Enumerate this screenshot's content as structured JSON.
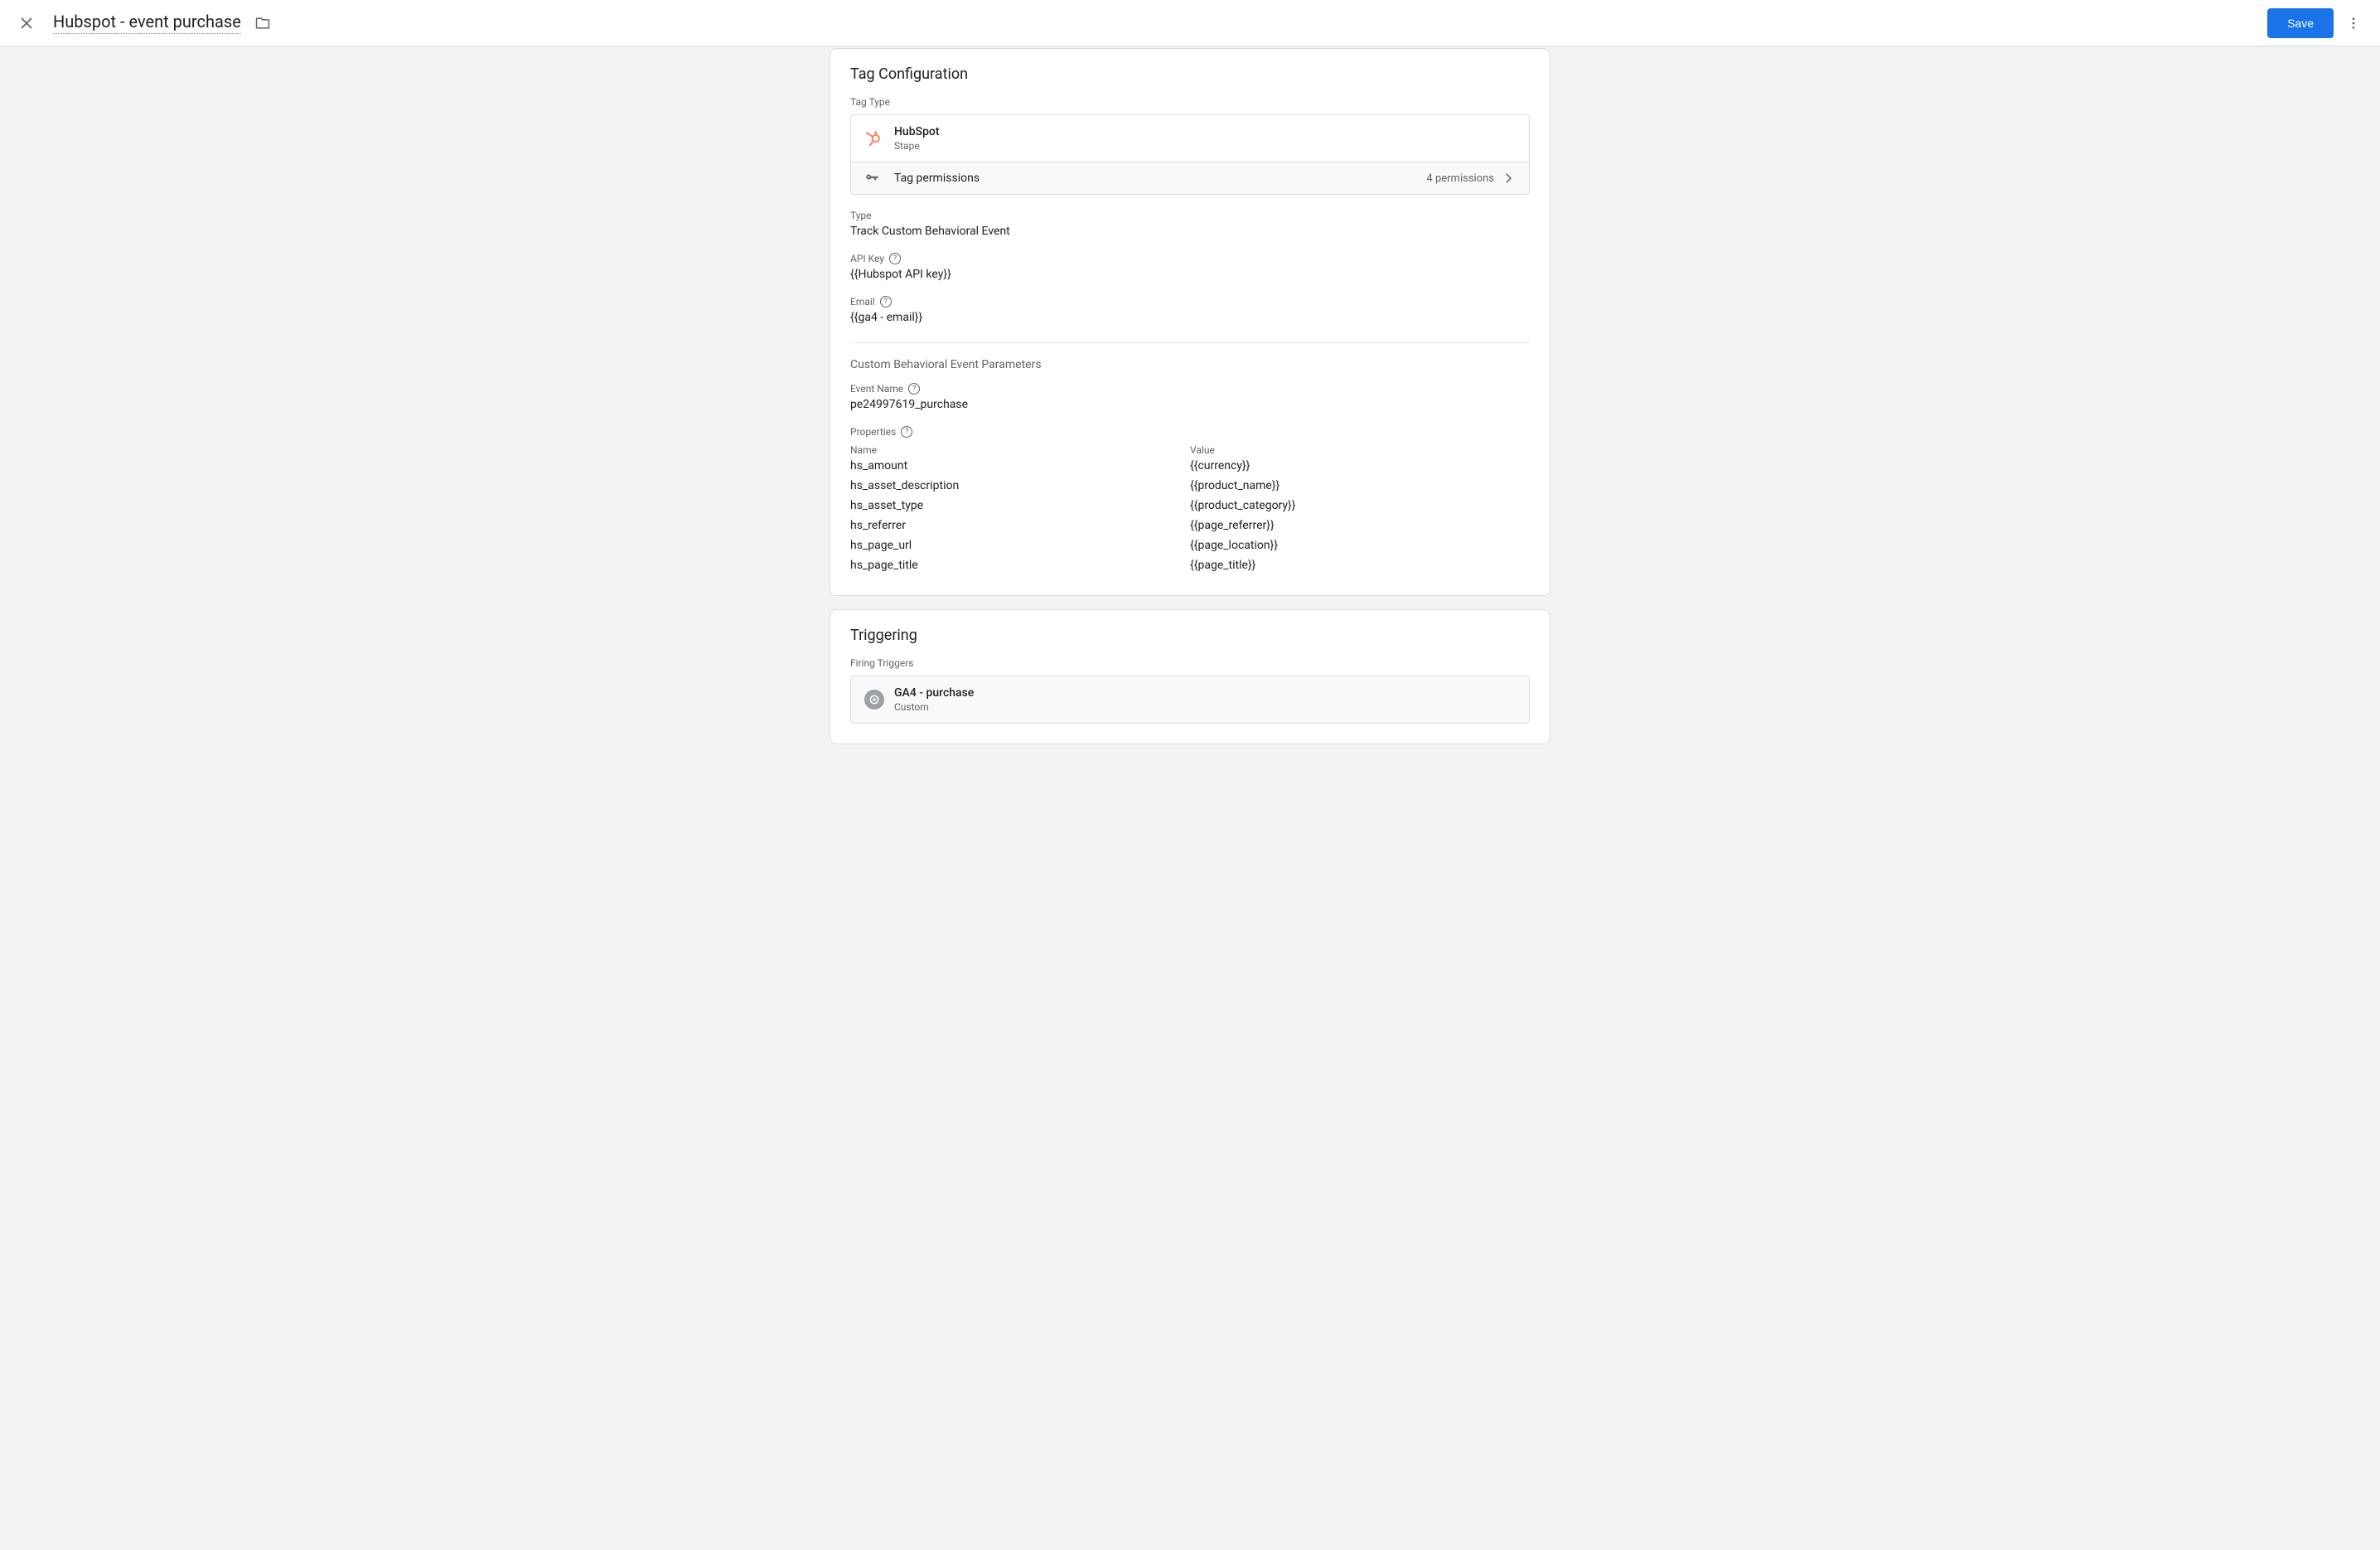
{
  "header": {
    "title": "Hubspot - event purchase",
    "save_label": "Save"
  },
  "tag_config": {
    "heading": "Tag Configuration",
    "tag_type_label": "Tag Type",
    "tag_name": "HubSpot",
    "tag_vendor": "Stape",
    "permissions_label": "Tag permissions",
    "permissions_count": "4 permissions",
    "type_label": "Type",
    "type_value": "Track Custom Behavioral Event",
    "api_key_label": "API Key",
    "api_key_value": "{{Hubspot API key}}",
    "email_label": "Email",
    "email_value": "{{ga4 - email}}",
    "params_heading": "Custom Behavioral Event Parameters",
    "event_name_label": "Event Name",
    "event_name_value": "pe24997619_purchase",
    "properties_label": "Properties",
    "col_name": "Name",
    "col_value": "Value",
    "properties": [
      {
        "name": "hs_amount",
        "value": "{{currency}}"
      },
      {
        "name": "hs_asset_description",
        "value": "{{product_name}}"
      },
      {
        "name": "hs_asset_type",
        "value": "{{product_category}}"
      },
      {
        "name": "hs_referrer",
        "value": "{{page_referrer}}"
      },
      {
        "name": "hs_page_url",
        "value": "{{page_location}}"
      },
      {
        "name": "hs_page_title",
        "value": "{{page_title}}"
      }
    ]
  },
  "triggering": {
    "heading": "Triggering",
    "firing_label": "Firing Triggers",
    "trigger_name": "GA4 - purchase",
    "trigger_type": "Custom"
  }
}
